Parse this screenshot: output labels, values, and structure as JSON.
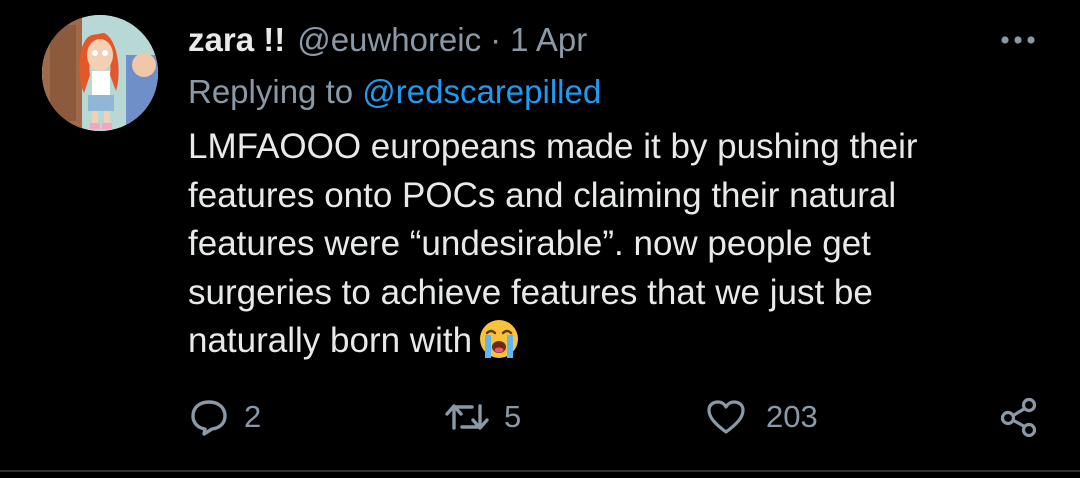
{
  "tweet": {
    "display_name": "zara !!",
    "handle": "@euwhoreic",
    "separator": "·",
    "date": "1 Apr",
    "replying_prefix": "Replying to ",
    "replying_to": "@redscarepilled",
    "text_lines": [
      "LMFAOOO europeans made it by pushing their",
      "features onto POCs and claiming their natural",
      "features were “undesirable”. now people get",
      "surgeries to achieve features that we just be",
      "naturally born with"
    ],
    "emoji": "loudly-crying-face"
  },
  "actions": {
    "reply_count": "2",
    "retweet_count": "5",
    "like_count": "203"
  },
  "icons": {
    "more": "more-horizontal-icon",
    "reply": "reply-bubble-icon",
    "retweet": "retweet-icon",
    "like": "heart-icon",
    "share": "share-icon"
  },
  "colors": {
    "background": "#000000",
    "text_primary": "#e7e9ea",
    "text_secondary": "#8b98a5",
    "link": "#1d9bf0",
    "divider": "#2f3336"
  }
}
